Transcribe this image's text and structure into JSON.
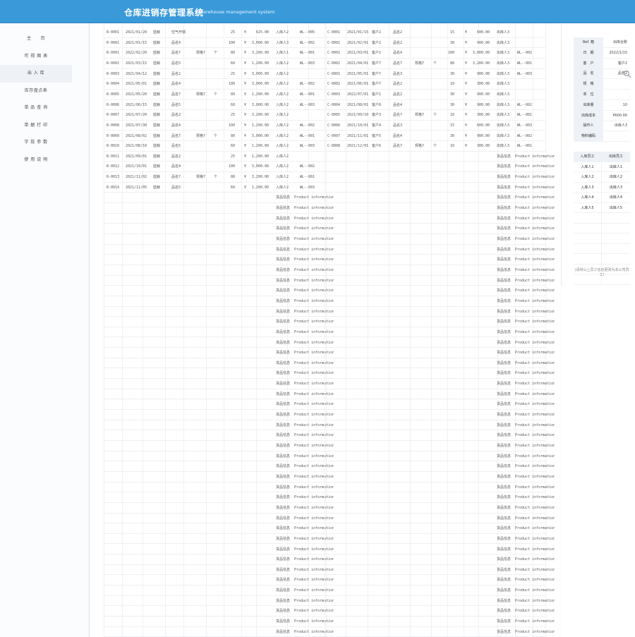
{
  "header": {
    "title": "仓库进销存管理系统",
    "subtitle": "Warehouse management system"
  },
  "sidebar": {
    "items": [
      {
        "label": "主　　页",
        "active": false
      },
      {
        "label": "可 视 图 表",
        "active": false
      },
      {
        "label": "出 入 库",
        "active": true
      },
      {
        "label": "库存盘点表",
        "active": false
      },
      {
        "label": "单 品 查 询",
        "active": false
      },
      {
        "label": "单 据 打 印",
        "active": false
      },
      {
        "label": "字 段 参 数",
        "active": false
      },
      {
        "label": "使 用 说 明",
        "active": false
      }
    ]
  },
  "inbound": [
    [
      "R-0001",
      "2021/01/20",
      "蓝鲸",
      "空气开锅",
      "",
      "",
      "25",
      "¥",
      "625.00",
      "入库人2",
      "WL--005"
    ],
    [
      "R-0001",
      "2021/01/15",
      "蓝鲸",
      "品名4",
      "",
      "",
      "100",
      "¥",
      "3,000.00",
      "入库人3",
      "WL--002"
    ],
    [
      "R-0001",
      "2022/02/20",
      "蓝鲸",
      "品名7",
      "规格7",
      "个",
      "80",
      "¥",
      "3,200.00",
      "入库人1",
      "WL--001"
    ],
    [
      "R-0002",
      "2021/03/15",
      "蓝鲸",
      "品名5",
      "",
      "",
      "60",
      "¥",
      "1,200.00",
      "入库人2",
      "WL--003"
    ],
    [
      "R-0003",
      "2021/04/12",
      "蓝鲸",
      "品名2",
      "",
      "",
      "25",
      "¥",
      "3,000.00",
      "入库人2",
      ""
    ],
    [
      "R-0004",
      "2021/05/01",
      "蓝鲸",
      "品名4",
      "",
      "",
      "100",
      "¥",
      "3,000.00",
      "入库人2",
      "WL--002"
    ],
    [
      "R-0005",
      "2021/05/20",
      "蓝鲸",
      "品名7",
      "规格7",
      "个",
      "80",
      "¥",
      "1,200.00",
      "入库人2",
      "WL--001"
    ],
    [
      "R-0006",
      "2021/06/15",
      "蓝鲸",
      "品名5",
      "",
      "",
      "60",
      "¥",
      "3,000.00",
      "入库人2",
      "WL--003"
    ],
    [
      "R-0007",
      "2021/07/20",
      "蓝鲸",
      "品名2",
      "",
      "",
      "25",
      "¥",
      "3,200.00",
      "入库人2",
      ""
    ],
    [
      "R-0008",
      "2021/07/30",
      "蓝鲸",
      "品名4",
      "",
      "",
      "100",
      "¥",
      "1,200.00",
      "入库人2",
      "WL--002"
    ],
    [
      "R-0009",
      "2021/08/02",
      "蓝鲸",
      "品名7",
      "规格7",
      "个",
      "80",
      "¥",
      "3,000.00",
      "入库人2",
      "WL--001"
    ],
    [
      "R-0010",
      "2021/08/10",
      "蓝鲸",
      "品名5",
      "",
      "",
      "60",
      "¥",
      "1,200.00",
      "入库人2",
      "WL--003"
    ],
    [
      "R-0011",
      "2021/09/01",
      "蓝鲸",
      "品名2",
      "",
      "",
      "25",
      "¥",
      "1,200.00",
      "入库人2",
      ""
    ],
    [
      "R-0012",
      "2021/10/01",
      "蓝鲸",
      "品名4",
      "",
      "",
      "100",
      "¥",
      "3,000.00",
      "入库人2",
      "WL--002"
    ],
    [
      "R-0013",
      "2021/11/02",
      "蓝鲸",
      "品名7",
      "规格7",
      "个",
      "80",
      "¥",
      "3,200.00",
      "入库人2",
      "WL--001"
    ],
    [
      "R-0014",
      "2021/11/05",
      "蓝鲸",
      "品名5",
      "",
      "",
      "60",
      "¥",
      "1,200.00",
      "入库人2",
      "WL--003"
    ]
  ],
  "outbound": [
    [
      "C-0001",
      "2021/01/15",
      "客户2",
      "品名2",
      "",
      "",
      "15",
      "¥",
      "600.00",
      "出库人3",
      ""
    ],
    [
      "C-0001",
      "2021/02/01",
      "客户2",
      "品名2",
      "",
      "",
      "30",
      "¥",
      "900.00",
      "出库人3",
      ""
    ],
    [
      "C-0001",
      "2021/03/01",
      "客户2",
      "品名4",
      "",
      "",
      "100",
      "¥",
      "3,000.00",
      "出库人3",
      "WL--002"
    ],
    [
      "C-0002",
      "2021/04/01",
      "客户7",
      "品名7",
      "规格7",
      "个",
      "80",
      "¥",
      "3,200.00",
      "出库人3",
      "WL--001"
    ],
    [
      "C-0001",
      "2021/05/01",
      "客户7",
      "品名3",
      "",
      "",
      "30",
      "¥",
      "900.00",
      "出库人3",
      "WL--003"
    ],
    [
      "C-0002",
      "2021/06/01",
      "客户7",
      "品名2",
      "",
      "",
      "10",
      "¥",
      "300.00",
      "出库人3",
      ""
    ],
    [
      "C-0003",
      "2022/07/01",
      "客户1",
      "品名2",
      "",
      "",
      "30",
      "¥",
      "900.00",
      "出库人3",
      ""
    ],
    [
      "C-0004",
      "2021/08/01",
      "客户8",
      "品名4",
      "",
      "",
      "30",
      "¥",
      "900.00",
      "出库人3",
      "WL--002"
    ],
    [
      "C-0005",
      "2021/09/10",
      "客户3",
      "品名7",
      "规格7",
      "个",
      "10",
      "¥",
      "300.00",
      "出库人3",
      "WL--001"
    ],
    [
      "C-0006",
      "2021/10/01",
      "客户4",
      "品名3",
      "",
      "",
      "15",
      "¥",
      "600.00",
      "出库人3",
      "WL--003"
    ],
    [
      "C-0007",
      "2021/11/01",
      "客户5",
      "品名4",
      "",
      "",
      "30",
      "¥",
      "900.00",
      "出库人3",
      "WL--002"
    ],
    [
      "C-0008",
      "2021/12/01",
      "客户6",
      "品名7",
      "规格7",
      "个",
      "10",
      "¥",
      "300.00",
      "出库人3",
      "WL--001"
    ]
  ],
  "placeholder": {
    "cn": "货品信息",
    "en": "Product information"
  },
  "form": {
    "fields": [
      {
        "label": "Ref. 箱",
        "value": "出库台账"
      },
      {
        "label": "日　期",
        "value": "2022/1/15"
      },
      {
        "label": "客　户",
        "value": "客户2"
      },
      {
        "label": "品　名",
        "value": "品名2"
      },
      {
        "label": "规　格",
        "value": ""
      },
      {
        "label": "单　位",
        "value": ""
      },
      {
        "label": "出库量",
        "value": "10"
      },
      {
        "label": "出库成本",
        "value": "¥600.00"
      },
      {
        "label": "操作人",
        "value": "出库人3"
      },
      {
        "label": "物料编码",
        "value": ""
      }
    ]
  },
  "staff": {
    "headers": [
      "入库员工",
      "出库员工"
    ],
    "rows": [
      [
        "入库人1",
        "出库人1"
      ],
      [
        "入库人2",
        "出库人2"
      ],
      [
        "入库人3",
        "出库人3"
      ],
      [
        "入库人4",
        "出库人4"
      ],
      [
        "入库人5",
        "出库人5"
      ],
      [
        "",
        ""
      ],
      [
        "",
        ""
      ],
      [
        "",
        ""
      ],
      [
        "",
        ""
      ],
      [
        "",
        ""
      ],
      [
        "",
        ""
      ],
      [
        "",
        ""
      ]
    ],
    "note": "(请将以上员工信息更改为本公司员工)"
  },
  "colors": {
    "header_bg": "#3a9ad9",
    "form_label_bg": "#eef1f6"
  },
  "icons": {
    "search": "search-icon"
  }
}
